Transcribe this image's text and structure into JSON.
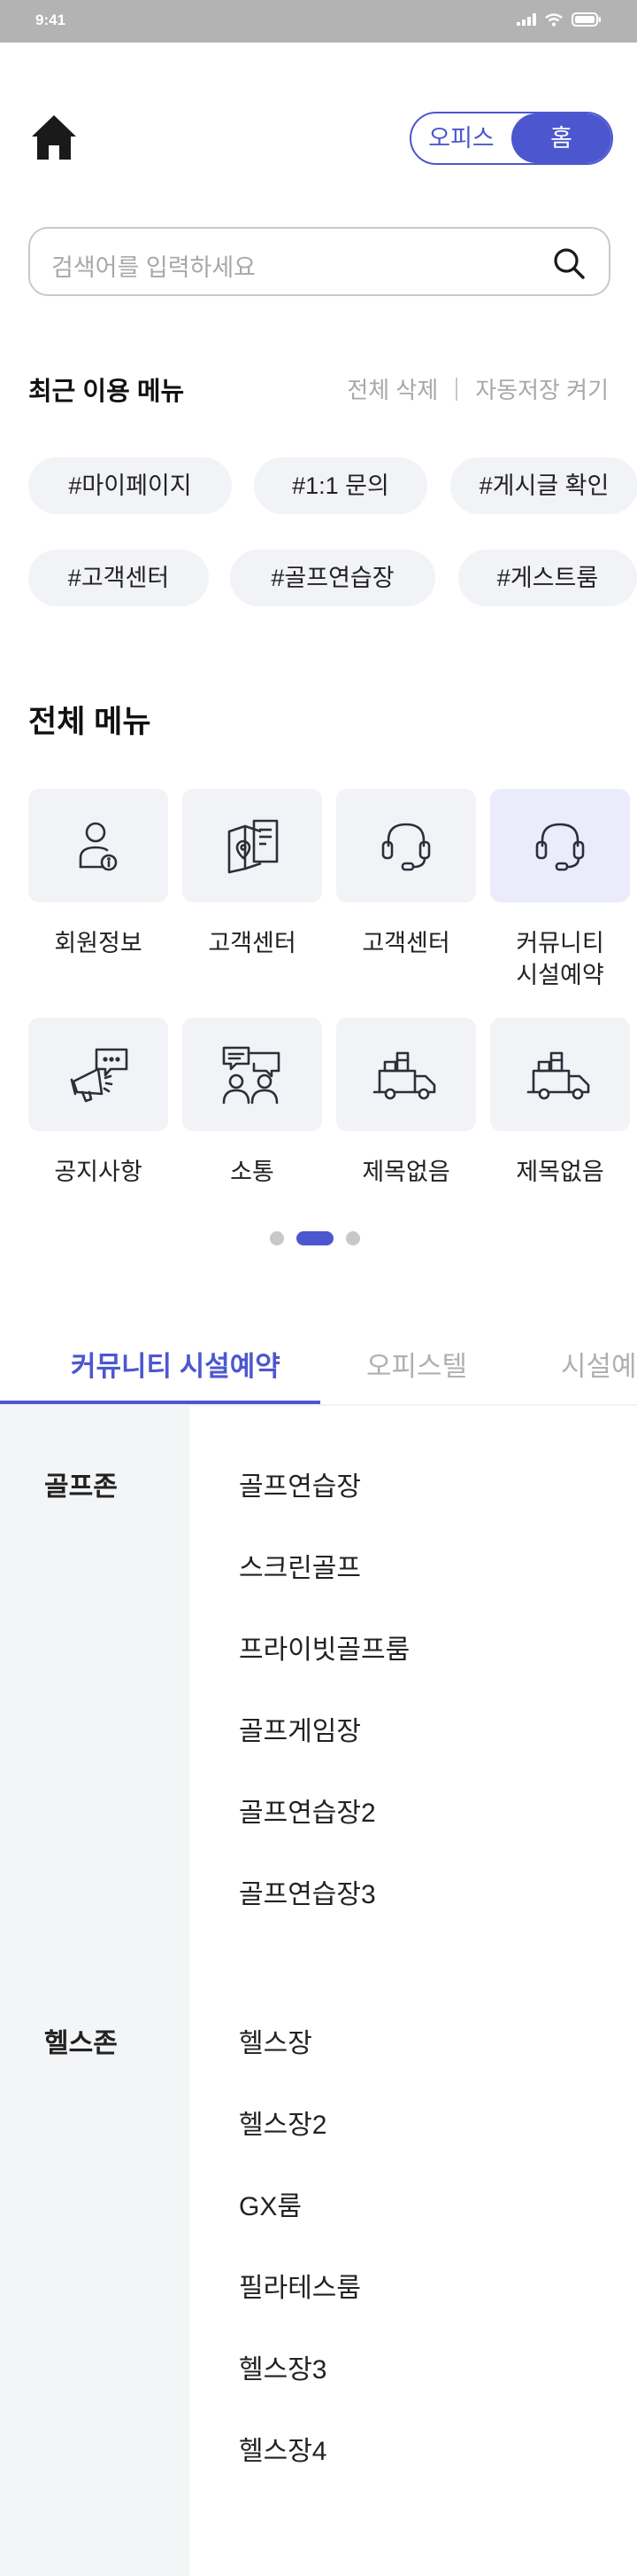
{
  "status_bar": {
    "time": "9:41"
  },
  "header": {
    "toggle": {
      "options": [
        "오피스",
        "홈"
      ],
      "active_index": 1
    }
  },
  "search": {
    "placeholder": "검색어를 입력하세요"
  },
  "recent": {
    "title": "최근 이용 메뉴",
    "delete_all": "전체 삭제",
    "auto_save": "자동저장 켜기",
    "chips": [
      "#마이페이지",
      "#1:1 문의",
      "#게시글 확인",
      "#고객센터",
      "#골프연습장",
      "#게스트룸"
    ]
  },
  "all_menu": {
    "title": "전체 메뉴",
    "tiles": [
      {
        "icon": "person-info-icon",
        "label": "회원정보",
        "selected": false
      },
      {
        "icon": "map-document-icon",
        "label": "고객센터",
        "selected": false
      },
      {
        "icon": "headset-icon",
        "label": "고객센터",
        "selected": false
      },
      {
        "icon": "headset-icon",
        "label": "커뮤니티\n시설예약",
        "selected": true
      },
      {
        "icon": "megaphone-icon",
        "label": "공지사항",
        "selected": false
      },
      {
        "icon": "people-chat-icon",
        "label": "소통",
        "selected": false
      },
      {
        "icon": "truck-icon",
        "label": "제목없음",
        "selected": false
      },
      {
        "icon": "truck-icon",
        "label": "제목없음",
        "selected": false
      }
    ],
    "pagination": {
      "pages": 3,
      "current": 2
    }
  },
  "tabs": [
    "커뮤니티 시설예약",
    "오피스텔",
    "시설예약"
  ],
  "categories": [
    {
      "name": "골프존",
      "items": [
        "골프연습장",
        "스크린골프",
        "프라이빗골프룸",
        "골프게임장",
        "골프연습장2",
        "골프연습장3"
      ]
    },
    {
      "name": "헬스존",
      "items": [
        "헬스장",
        "헬스장2",
        "GX룸",
        "필라테스룸",
        "헬스장3",
        "헬스장4"
      ]
    }
  ],
  "colors": {
    "accent": "#4c57cf",
    "tile_bg": "#f2f3f6",
    "tile_selected_bg": "#eaecfb",
    "icon": "#2b2f3a"
  }
}
